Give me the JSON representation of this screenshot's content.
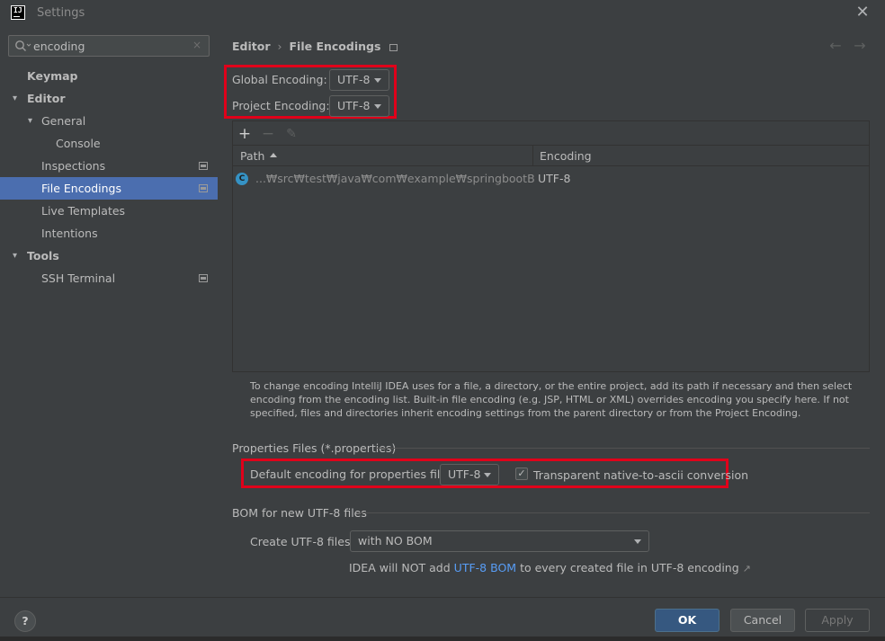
{
  "window": {
    "title": "Settings",
    "logo": "IJ",
    "close_icon": "close-icon"
  },
  "sidebar": {
    "search": {
      "value": "encoding",
      "clear": "×"
    },
    "items": [
      {
        "label": "Keymap",
        "bold": true
      },
      {
        "label": "Editor",
        "bold": true,
        "expanded": true
      },
      {
        "label": "General",
        "expanded": true
      },
      {
        "label": "Console"
      },
      {
        "label": "Inspections",
        "project_icon": true
      },
      {
        "label": "File Encodings",
        "project_icon": true,
        "selected": true
      },
      {
        "label": "Live Templates"
      },
      {
        "label": "Intentions"
      },
      {
        "label": "Tools",
        "bold": true,
        "expanded": true
      },
      {
        "label": "SSH Terminal",
        "project_icon": true
      }
    ]
  },
  "breadcrumb": {
    "parent": "Editor",
    "separator": "›",
    "current": "File Encodings"
  },
  "encodings": {
    "global_label": "Global Encoding:",
    "global_value": "UTF-8",
    "project_label": "Project Encoding:",
    "project_value": "UTF-8"
  },
  "table": {
    "toolbar": {
      "add": "+",
      "remove": "−",
      "edit": "✎"
    },
    "columns": {
      "path": "Path",
      "encoding": "Encoding"
    },
    "rows": [
      {
        "icon": "C",
        "path": "...₩src₩test₩java₩com₩example₩springbootBoard₩conf",
        "encoding": "UTF-8"
      }
    ]
  },
  "help_text": "To change encoding IntelliJ IDEA uses for a file, a directory, or the entire project, add its path if necessary and then select encoding from the encoding list. Built-in file encoding (e.g. JSP, HTML or XML) overrides encoding you specify here. If not specified, files and directories inherit encoding settings from the parent directory or from the Project Encoding.",
  "properties": {
    "section_title": "Properties Files (*.properties)",
    "default_label": "Default encoding for properties files:",
    "default_value": "UTF-8",
    "transparent_checked": true,
    "transparent_label": "Transparent native-to-ascii conversion"
  },
  "bom": {
    "section_title": "BOM for new UTF-8 files",
    "create_label": "Create UTF-8 files:",
    "create_value": "with NO BOM",
    "note_prefix": "IDEA will NOT add",
    "note_link": "UTF-8 BOM",
    "note_suffix": "to every created file in UTF-8 encoding",
    "note_arrow": "↗"
  },
  "footer": {
    "help": "?",
    "ok": "OK",
    "cancel": "Cancel",
    "apply": "Apply"
  },
  "colors": {
    "accent": "#4b6eaf",
    "highlight": "#e0001a",
    "link": "#589df6"
  }
}
